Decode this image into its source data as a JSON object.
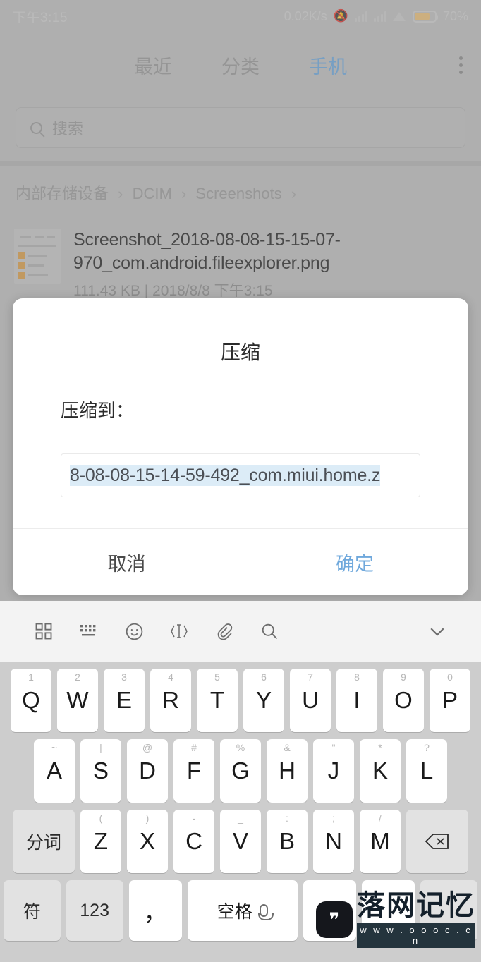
{
  "statusbar": {
    "time": "下午3:15",
    "netspeed": "0.02K/s",
    "mute_icon": "mute-bell-icon",
    "signal1_icon": "signal-bars-icon",
    "signal2_icon": "signal-bars-icon",
    "wifi_icon": "wifi-icon",
    "battery_icon": "battery-icon",
    "battery_percent": "70%"
  },
  "tabs": {
    "items": [
      {
        "label": "最近",
        "active": false
      },
      {
        "label": "分类",
        "active": false
      },
      {
        "label": "手机",
        "active": true
      }
    ],
    "overflow_icon": "more-vertical-icon",
    "active_color": "#6fa8dc"
  },
  "search": {
    "icon": "search-icon",
    "placeholder": "搜索",
    "value": ""
  },
  "breadcrumb": {
    "parts": [
      "内部存储设备",
      "DCIM",
      "Screenshots"
    ],
    "separator": "›"
  },
  "file": {
    "name": "Screenshot_2018-08-08-15-15-07-970_com.android.fileexplorer.png",
    "meta": "111.43 KB | 2018/8/8 下午3:15",
    "thumb_icon": "image-thumbnail"
  },
  "dialog": {
    "title": "压缩",
    "label": "压缩到：",
    "input_value": "8-08-08-15-14-59-492_com.miui.home.z",
    "input_selected": true,
    "selection_color": "#dcecf7",
    "cancel_label": "取消",
    "ok_label": "确定",
    "ok_color": "#6fa8dc"
  },
  "keyboard": {
    "toolbar": [
      {
        "icon": "grid-apps-icon"
      },
      {
        "icon": "keyboard-icon"
      },
      {
        "icon": "emoji-icon"
      },
      {
        "icon": "cursor-move-icon"
      },
      {
        "icon": "clipboard-icon"
      },
      {
        "icon": "search-icon"
      }
    ],
    "collapse_icon": "chevron-down-icon",
    "row1": [
      {
        "key": "Q",
        "sup": "1"
      },
      {
        "key": "W",
        "sup": "2"
      },
      {
        "key": "E",
        "sup": "3"
      },
      {
        "key": "R",
        "sup": "4"
      },
      {
        "key": "T",
        "sup": "5"
      },
      {
        "key": "Y",
        "sup": "6"
      },
      {
        "key": "U",
        "sup": "7"
      },
      {
        "key": "I",
        "sup": "8"
      },
      {
        "key": "O",
        "sup": "9"
      },
      {
        "key": "P",
        "sup": "0"
      }
    ],
    "row2": [
      {
        "key": "A",
        "sup": "~"
      },
      {
        "key": "S",
        "sup": "|"
      },
      {
        "key": "D",
        "sup": "@"
      },
      {
        "key": "F",
        "sup": "#"
      },
      {
        "key": "G",
        "sup": "%"
      },
      {
        "key": "H",
        "sup": "&"
      },
      {
        "key": "J",
        "sup": "\""
      },
      {
        "key": "K",
        "sup": "*"
      },
      {
        "key": "L",
        "sup": "?"
      }
    ],
    "row3_left": "分词",
    "row3": [
      {
        "key": "Z",
        "sup": "("
      },
      {
        "key": "X",
        "sup": ")"
      },
      {
        "key": "C",
        "sup": "-"
      },
      {
        "key": "V",
        "sup": "_"
      },
      {
        "key": "B",
        "sup": ":"
      },
      {
        "key": "N",
        "sup": ";"
      },
      {
        "key": "M",
        "sup": "/"
      }
    ],
    "backspace_icon": "backspace-icon",
    "row4": [
      {
        "key": "符",
        "type": "func"
      },
      {
        "key": "123",
        "type": "func"
      },
      {
        "key": "，",
        "type": "normal"
      },
      {
        "key": "空格",
        "type": "space",
        "icon": "microphone-icon"
      },
      {
        "key": "。",
        "type": "normal"
      },
      {
        "key": "",
        "type": "normal"
      },
      {
        "key": "",
        "type": "func"
      }
    ]
  },
  "watermark": {
    "badge_icon": "swan-logo-icon",
    "title": "落网记忆",
    "url": "w w w . o o o c . c n"
  }
}
